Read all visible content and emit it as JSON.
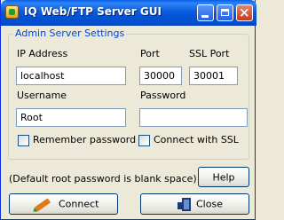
{
  "window": {
    "title": "IQ Web/FTP Server GUI"
  },
  "group": {
    "title": "Admin Server Settings",
    "ip_label": "IP Address",
    "ip_value": "localhost",
    "port_label": "Port",
    "port_value": "30000",
    "ssl_port_label": "SSL Port",
    "ssl_port_value": "30001",
    "username_label": "Username",
    "username_value": "Root",
    "password_label": "Password",
    "password_value": "",
    "remember_label": "Remember password",
    "remember_checked": false,
    "ssl_label": "Connect with SSL",
    "ssl_checked": false
  },
  "note": "(Default root password is blank space)",
  "buttons": {
    "help": "Help",
    "connect": "Connect",
    "close": "Close"
  },
  "icons": {
    "titlebar": [
      "app-icon",
      "minimize-icon",
      "maximize-icon",
      "close-icon"
    ],
    "connect": "pencil-icon",
    "close": "door-icon"
  },
  "colors": {
    "titlebar": "#0a5ce0",
    "group_title": "#0046d5",
    "background": "#ece9d8"
  }
}
